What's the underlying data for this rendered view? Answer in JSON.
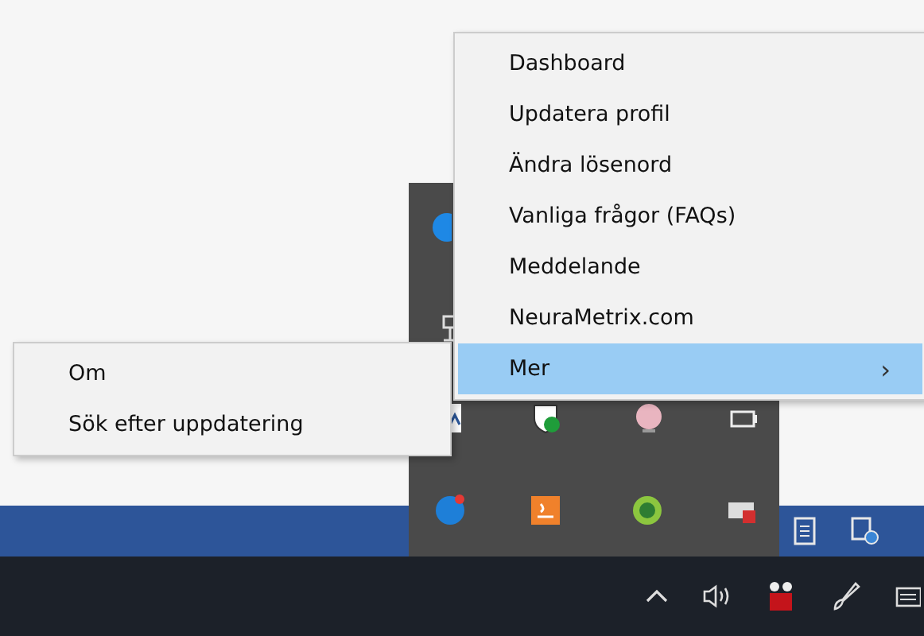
{
  "main_menu": {
    "items": [
      {
        "label": "Dashboard",
        "selected": false
      },
      {
        "label": "Updatera profil",
        "selected": false
      },
      {
        "label": "Ändra lösenord",
        "selected": false
      },
      {
        "label": "Vanliga frågor (FAQs)",
        "selected": false
      },
      {
        "label": "Meddelande",
        "selected": false
      },
      {
        "label": "NeuraMetrix.com",
        "selected": false
      },
      {
        "label": "Mer",
        "selected": true,
        "submenu_arrow": "›"
      }
    ]
  },
  "submenu": {
    "items": [
      {
        "label": "Om",
        "selected": false
      },
      {
        "label": "Sök efter uppdatering",
        "selected": false
      }
    ]
  }
}
